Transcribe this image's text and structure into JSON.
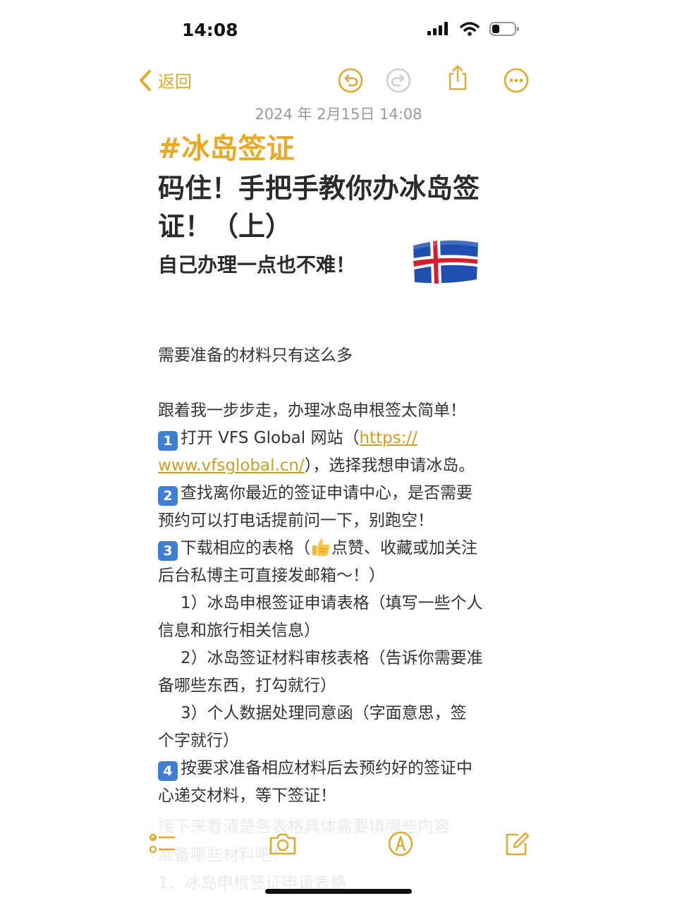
{
  "status_bar": {
    "time": "14:08"
  },
  "nav": {
    "back_label": "返回"
  },
  "note": {
    "date": "2024 年 2月15日 14:08",
    "tag": "#冰岛签证",
    "title_line1": "码住！手把手教你办冰岛签",
    "title_line2": "证！（上）",
    "subtitle": "自己办理一点也不难！",
    "flag_icon": "iceland-flag",
    "intro": "需要准备的材料只有这么多",
    "follow_me": "跟着我一步步走，办理冰岛申根签太简单！",
    "step1_num": "1",
    "step1_a": "打开 VFS Global 网站（",
    "step1_link_a": "https://",
    "step1_link_b": "www.vfsglobal.cn/",
    "step1_b": "），选择我想申请冰岛。",
    "step2_num": "2",
    "step2_a": "查找离你最近的签证申请中心，是否需要",
    "step2_b": "预约可以打电话提前问一下，别跑空！",
    "step3_num": "3",
    "step3_a1": "下载相应的表格（",
    "step3_a2": "点赞、收藏或加关注",
    "step3_b": "后台私博主可直接发邮箱～！）",
    "form1_a": "1）冰岛申根签证申请表格（填写一些个人",
    "form1_b": "信息和旅行相关信息）",
    "form2_a": "2）冰岛签证材料审核表格（告诉你需要准",
    "form2_b": "备哪些东西，打勾就行）",
    "form3_a": "3）个人数据处理同意函（字面意思，签",
    "form3_b": "个字就行）",
    "step4_num": "4",
    "step4_a": "按要求准备相应材料后去预约好的签证中",
    "step4_b": "心递交材料，等下签证！",
    "faded_1": "接下来看清楚各表格具体需要填哪些内容",
    "faded_2": "准备哪些材料吧！",
    "faded_3": "1、冰岛申根签证申请表格"
  },
  "colors": {
    "accent": "#e2a92b",
    "tag": "#e7aa22",
    "link": "#d39e1f",
    "keycap": "#3f7fd3"
  },
  "icons": {
    "status": [
      "cellular-signal-icon",
      "wifi-icon",
      "battery-icon"
    ],
    "nav": [
      "back-chevron-icon",
      "undo-icon",
      "redo-icon",
      "share-icon",
      "more-icon"
    ],
    "toolbar": [
      "checklist-icon",
      "camera-icon",
      "markup-icon",
      "compose-icon"
    ]
  }
}
